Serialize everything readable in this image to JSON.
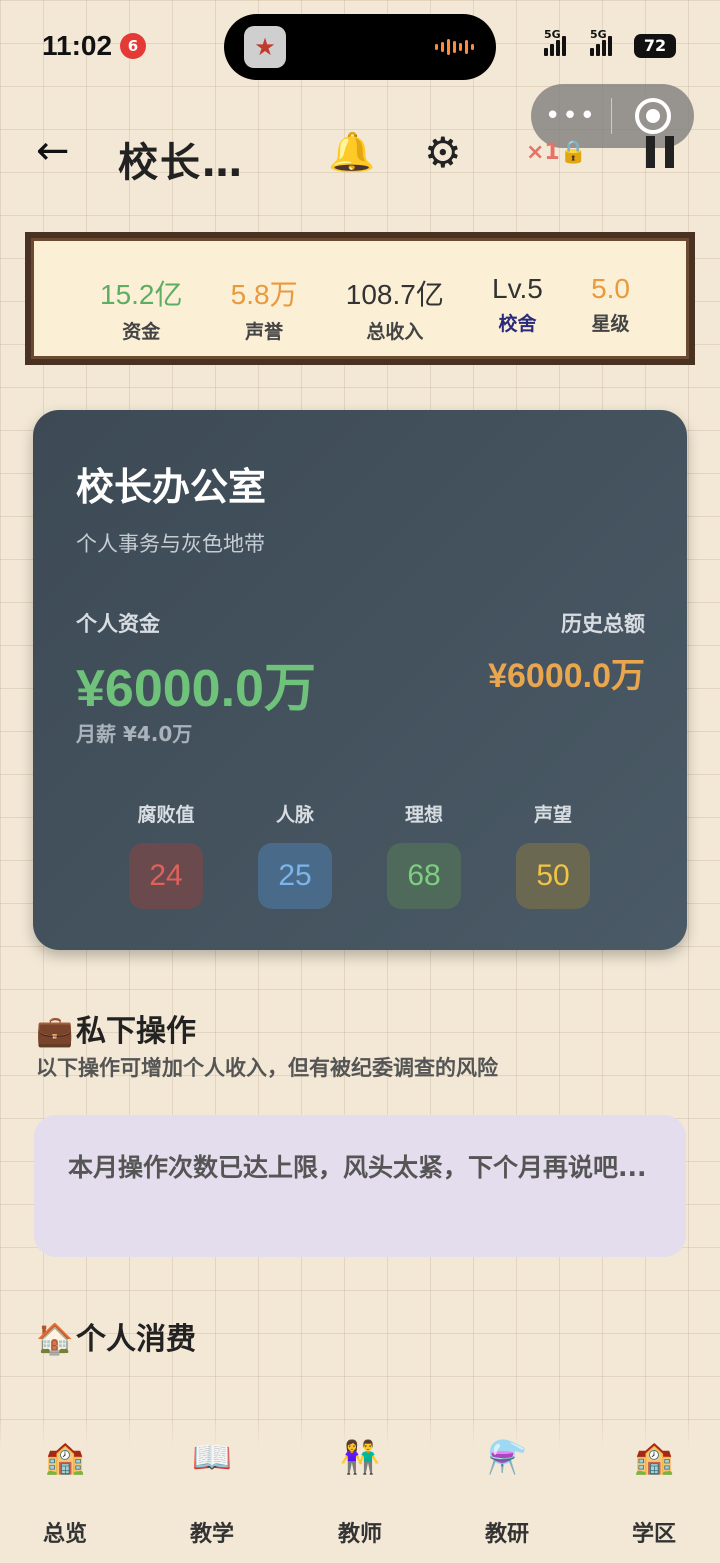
{
  "status_bar": {
    "time": "11:02",
    "notification_badge": "6",
    "signal1": "5G",
    "signal2": "5G",
    "battery": "72"
  },
  "header": {
    "back_label": "←",
    "title": "校长…",
    "lock_count": "×1🔒"
  },
  "stats": [
    {
      "value": "15.2亿",
      "label": "资金",
      "value_color": "#5cae62",
      "label_color": "#444444"
    },
    {
      "value": "5.8万",
      "label": "声誉",
      "value_color": "#e89a3c",
      "label_color": "#444444"
    },
    {
      "value": "108.7亿",
      "label": "总收入",
      "value_color": "#333333",
      "label_color": "#444444"
    },
    {
      "value": "Lv.5",
      "label": "校舍",
      "value_color": "#333333",
      "label_color": "#2a2a7a"
    },
    {
      "value": "5.0",
      "label": "星级",
      "value_color": "#e89a3c",
      "label_color": "#444444"
    }
  ],
  "office": {
    "title": "校长办公室",
    "subtitle": "个人事务与灰色地带",
    "personal_funds_label": "个人资金",
    "personal_funds": "¥6000.0万",
    "salary": "月薪 ¥4.0万",
    "history_label": "历史总额",
    "history_total": "¥6000.0万",
    "attributes": [
      {
        "name": "腐败值",
        "value": "24",
        "bg": "#6b4a4e",
        "color": "#e0615a"
      },
      {
        "name": "人脉",
        "value": "25",
        "bg": "#4a6a8a",
        "color": "#7ab6ec"
      },
      {
        "name": "理想",
        "value": "68",
        "bg": "#4f6a5a",
        "color": "#7ccf7e"
      },
      {
        "name": "声望",
        "value": "50",
        "bg": "#6a6850",
        "color": "#f1c445"
      }
    ]
  },
  "private_ops": {
    "title": "私下操作",
    "description": "以下操作可增加个人收入，但有被纪委调查的风险",
    "notice": "本月操作次数已达上限，风头太紧，下个月再说吧..."
  },
  "consumption": {
    "title": "个人消费"
  },
  "nav": [
    {
      "label": "总览",
      "icon": "🏫"
    },
    {
      "label": "教学",
      "icon": "📖"
    },
    {
      "label": "教师",
      "icon": "👫"
    },
    {
      "label": "教研",
      "icon": "⚗️"
    },
    {
      "label": "学区",
      "icon": "🏫"
    }
  ]
}
